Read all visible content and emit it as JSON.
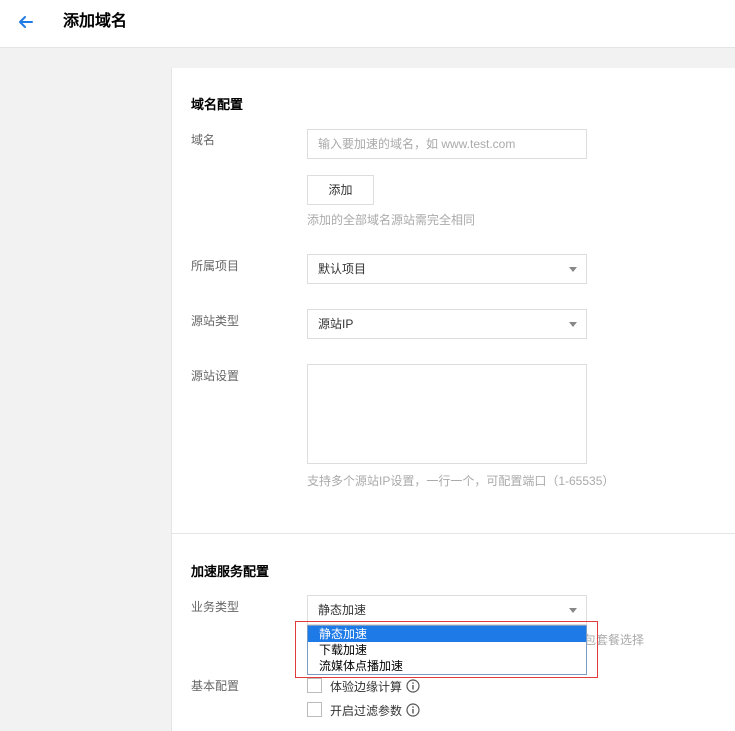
{
  "header": {
    "title": "添加域名",
    "back_icon": "arrow-left-icon"
  },
  "domain_section": {
    "title": "域名配置",
    "domain_label": "域名",
    "domain_placeholder": "输入要加速的域名，如 www.test.com",
    "add_button": "添加",
    "add_hint": "添加的全部域名源站需完全相同",
    "project_label": "所属项目",
    "project_value": "默认项目",
    "origin_type_label": "源站类型",
    "origin_type_value": "源站IP",
    "origin_settings_label": "源站设置",
    "origin_hint": "支持多个源站IP设置，一行一个，可配置端口（1-65535）"
  },
  "service_section": {
    "title": "加速服务配置",
    "business_type_label": "业务类型",
    "business_type_value": "静态加速",
    "business_hint_partial": "包套餐选择",
    "dropdown_options": [
      "静态加速",
      "下载加速",
      "流媒体点播加速"
    ],
    "dropdown_selected_index": 0,
    "basic_config_label": "基本配置",
    "checkboxes": [
      {
        "label": "体验边缘计算",
        "checked": false,
        "icon": "info-icon"
      },
      {
        "label": "开启过滤参数",
        "checked": false,
        "icon": "info-icon"
      }
    ]
  },
  "colors": {
    "accent": "#1e7ae6",
    "highlight": "#e03c3c"
  }
}
